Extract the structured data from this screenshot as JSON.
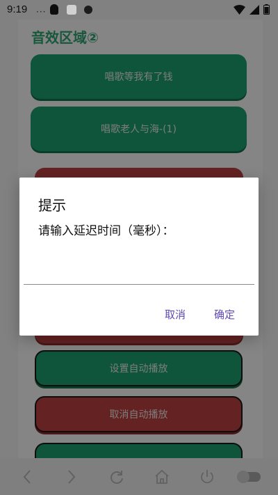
{
  "status_bar": {
    "time": "9:19",
    "dots": "···"
  },
  "page": {
    "section_title": "音效区域②",
    "buttons": [
      {
        "label": "唱歌等我有了钱",
        "color": "green"
      },
      {
        "label": "唱歌老人与海-(1)",
        "color": "green"
      },
      {
        "label": "",
        "color": "red"
      },
      {
        "label": "",
        "color": "red"
      },
      {
        "label": "设置自动播放",
        "color": "green"
      },
      {
        "label": "取消自动播放",
        "color": "red"
      },
      {
        "label": "",
        "color": "green"
      }
    ]
  },
  "dialog": {
    "title": "提示",
    "message": "请输入延迟时间（毫秒）：",
    "input_value": "",
    "input_placeholder": "",
    "cancel_label": "取消",
    "ok_label": "确定"
  },
  "bottom_nav": {
    "items": [
      "back-icon",
      "forward-icon",
      "refresh-icon",
      "home-icon",
      "power-icon",
      "toggle-icon"
    ]
  },
  "colors": {
    "dialog_button": "#5f49b3",
    "green_button": "#12684a",
    "red_button": "#7b2a2a",
    "section_title": "#1f6b4a"
  }
}
